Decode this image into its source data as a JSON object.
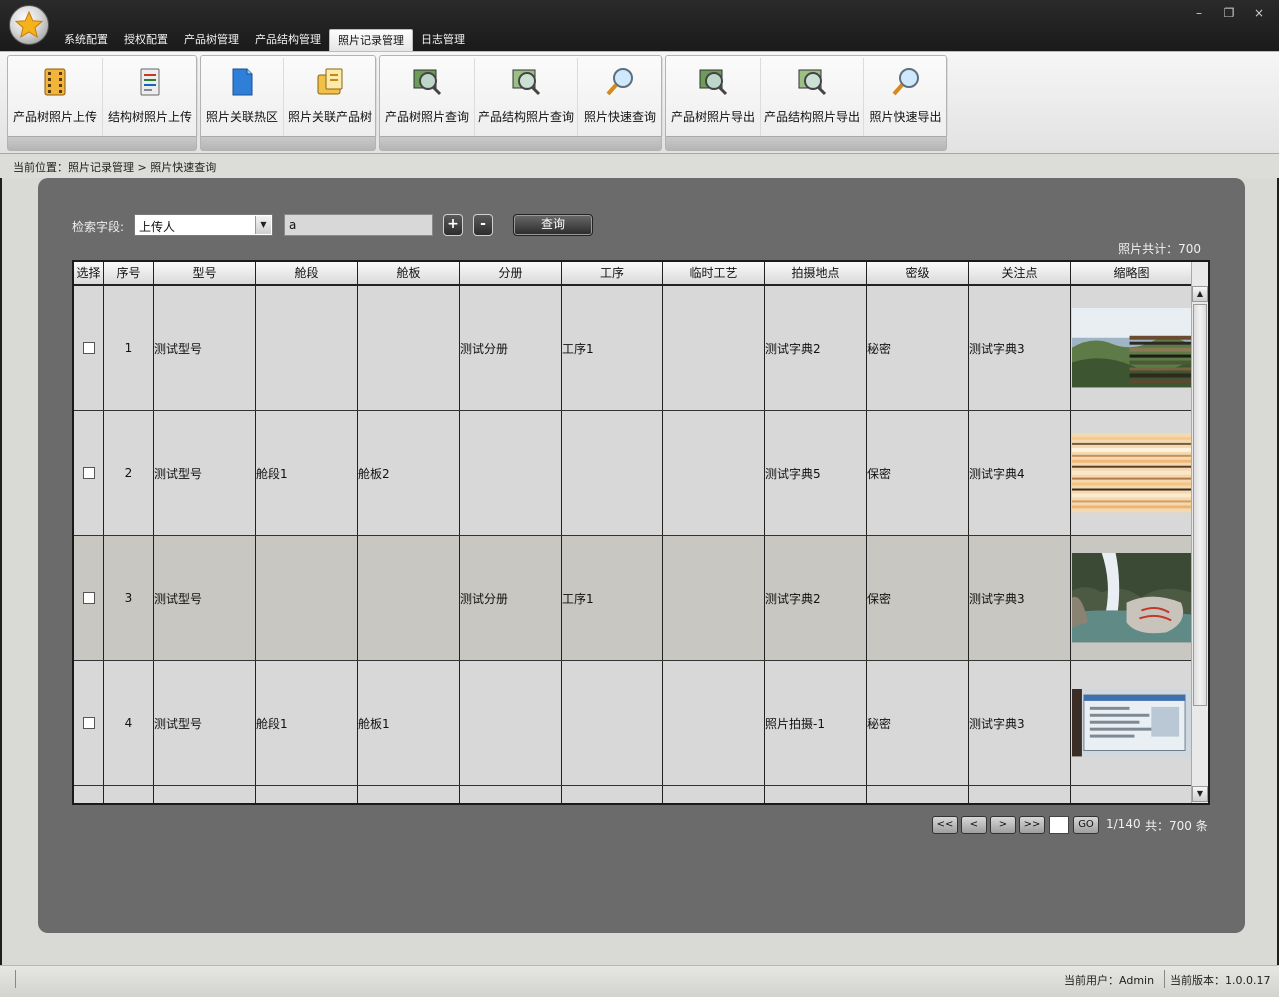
{
  "window": {
    "minimize": "–",
    "restore": "❐",
    "close": "×"
  },
  "menu": {
    "tabs": [
      {
        "label": "系统配置"
      },
      {
        "label": "授权配置"
      },
      {
        "label": "产品树管理"
      },
      {
        "label": "产品结构管理"
      },
      {
        "label": "照片记录管理",
        "active": true
      },
      {
        "label": "日志管理"
      }
    ]
  },
  "ribbon": {
    "buttons": [
      {
        "label": "产品树照片上传",
        "icon": "film-upload-icon"
      },
      {
        "label": "结构树照片上传",
        "icon": "document-upload-icon"
      },
      {
        "label": "照片关联热区",
        "icon": "blue-document-icon"
      },
      {
        "label": "照片关联产品树",
        "icon": "folder-link-icon"
      },
      {
        "label": "产品树照片查询",
        "icon": "photo-search-icon"
      },
      {
        "label": "产品结构照片查询",
        "icon": "photo-search-icon"
      },
      {
        "label": "照片快速查询",
        "icon": "magnifier-icon"
      },
      {
        "label": "产品树照片导出",
        "icon": "photo-export-icon"
      },
      {
        "label": "产品结构照片导出",
        "icon": "photo-export-icon"
      },
      {
        "label": "照片快速导出",
        "icon": "magnifier-icon"
      }
    ]
  },
  "breadcrumb": "当前位置：照片记录管理 > 照片快速查询",
  "search": {
    "label": "检索字段:",
    "field": "上传人",
    "value": "a",
    "add": "+",
    "remove": "-",
    "query": "查询",
    "total": "照片共计：700"
  },
  "table": {
    "columns": [
      "选择",
      "序号",
      "型号",
      "舱段",
      "舱板",
      "分册",
      "工序",
      "临时工艺",
      "拍摄地点",
      "密级",
      "关注点",
      "缩略图"
    ],
    "rows": [
      {
        "no": "1",
        "model": "测试型号",
        "section": "",
        "board": "",
        "volume": "测试分册",
        "process": "工序1",
        "temp": "",
        "location": "测试字典2",
        "secret": "秘密",
        "focus": "测试字典3",
        "thumb": "mountain-landscape"
      },
      {
        "no": "2",
        "model": "测试型号",
        "section": "舱段1",
        "board": "舱板2",
        "volume": "",
        "process": "",
        "temp": "",
        "location": "测试字典5",
        "secret": "保密",
        "focus": "测试字典4",
        "thumb": "striped-pattern"
      },
      {
        "no": "3",
        "model": "测试型号",
        "section": "",
        "board": "",
        "volume": "测试分册",
        "process": "工序1",
        "temp": "",
        "location": "测试字典2",
        "secret": "保密",
        "focus": "测试字典3",
        "thumb": "waterfall"
      },
      {
        "no": "4",
        "model": "测试型号",
        "section": "舱段1",
        "board": "舱板1",
        "volume": "",
        "process": "",
        "temp": "",
        "location": "照片拍摄-1",
        "secret": "秘密",
        "focus": "测试字典3",
        "thumb": "screen-photo"
      }
    ]
  },
  "pager": {
    "first": "<<",
    "prev": "<",
    "next": ">",
    "last": ">>",
    "go": "GO",
    "page": "1/140",
    "count": "共：700 条"
  },
  "status": {
    "user": "当前用户：Admin",
    "version": "当前版本：1.0.0.17"
  }
}
